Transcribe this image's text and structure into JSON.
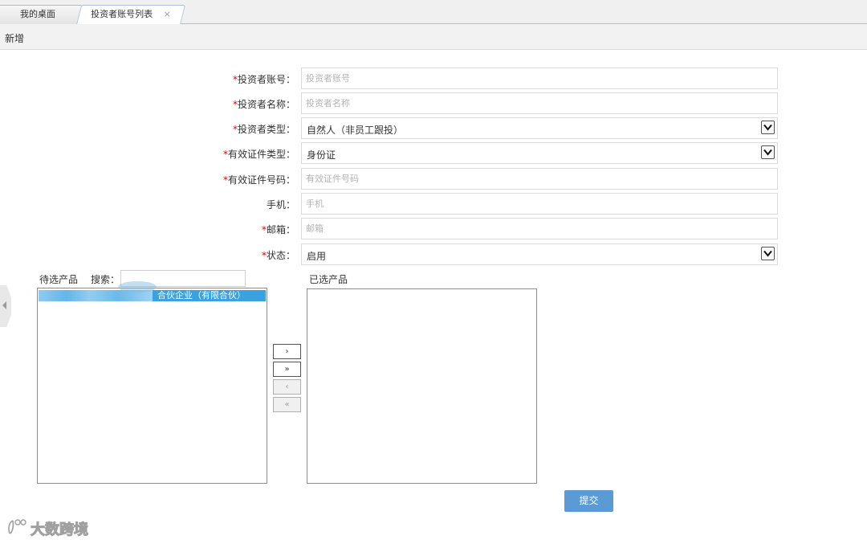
{
  "tabs": [
    {
      "label": "我的桌面"
    },
    {
      "label": "投资者账号列表",
      "close": "×"
    }
  ],
  "toolbar": {
    "add_label": "新增"
  },
  "form": {
    "required_mark": "*",
    "account": {
      "label": "投资者账号：",
      "placeholder": "投资者账号"
    },
    "name": {
      "label": "投资者名称：",
      "placeholder": "投资者名称"
    },
    "type": {
      "label": "投资者类型：",
      "value": "自然人（非员工跟投）"
    },
    "id_type": {
      "label": "有效证件类型：",
      "value": "身份证"
    },
    "id_number": {
      "label": "有效证件号码：",
      "placeholder": "有效证件号码"
    },
    "phone": {
      "label": "手机：",
      "placeholder": "手机"
    },
    "email": {
      "label": "邮箱：",
      "placeholder": "邮箱"
    },
    "status": {
      "label": "状态：",
      "value": "启用"
    }
  },
  "products": {
    "pending_label": "待选产品",
    "search_label": "搜索：",
    "selected_label": "已选产品",
    "pending_items": [
      {
        "label": "合伙企业（有限合伙）"
      }
    ],
    "move_buttons": {
      "move_one_right": "›",
      "move_all_right": "»",
      "move_one_left": "‹",
      "move_all_left": "«"
    }
  },
  "submit_label": "提交",
  "watermark": {
    "text": "大数跨境"
  },
  "colors": {
    "accent": "#5b9bd5",
    "selected_item": "#3aa2e0",
    "required": "#e60000"
  }
}
